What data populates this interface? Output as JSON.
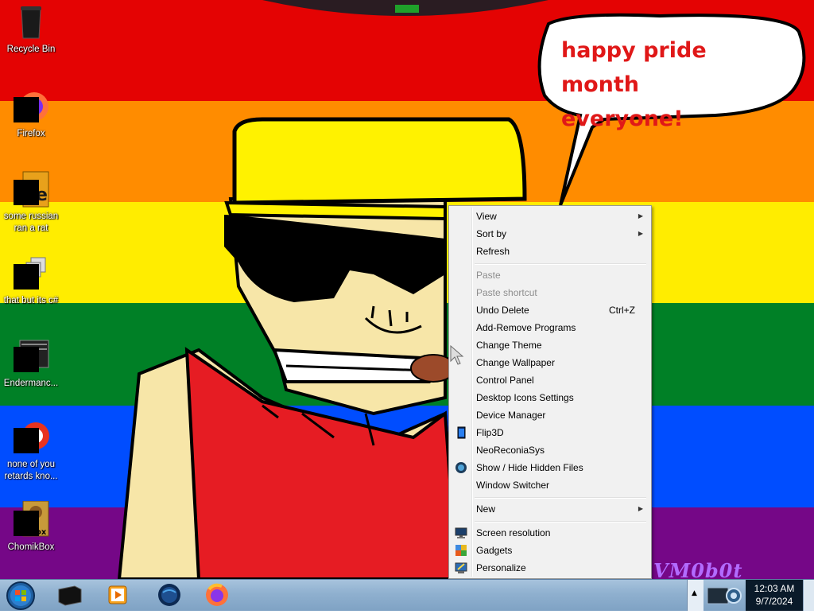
{
  "wallpaper": {
    "speech_bubble_text_line1": "happy pride month",
    "speech_bubble_text_line2": "everyone!",
    "signature": "VM0b0t",
    "flag_colors": [
      "#e40303",
      "#ff8c00",
      "#ffed00",
      "#008026",
      "#004dff",
      "#750787"
    ]
  },
  "desktop_icons": [
    {
      "label": "Recycle Bin",
      "icon": "recycle-bin-icon"
    },
    {
      "label": "Firefox",
      "icon": "firefox-icon"
    },
    {
      "label": "some russian ran a rat",
      "icon": "rat-program-icon"
    },
    {
      "label": "that but its c#",
      "icon": "windows-stack-icon"
    },
    {
      "label": "Endermanc...",
      "icon": "terminal-window-icon"
    },
    {
      "label": "none of you retards kno...",
      "icon": "red-circle-icon"
    },
    {
      "label": "ChomikBox",
      "icon": "chomikbox-hamster-icon"
    }
  ],
  "context_menu": {
    "items": [
      {
        "label": "View",
        "submenu": true
      },
      {
        "label": "Sort by",
        "submenu": true
      },
      {
        "label": "Refresh"
      },
      {
        "label": "Paste",
        "disabled": true
      },
      {
        "label": "Paste shortcut",
        "disabled": true
      },
      {
        "label": "Undo Delete",
        "shortcut": "Ctrl+Z"
      },
      {
        "label": "Add-Remove Programs"
      },
      {
        "label": "Change Theme"
      },
      {
        "label": "Change Wallpaper"
      },
      {
        "label": "Control Panel"
      },
      {
        "label": "Desktop Icons Settings"
      },
      {
        "label": "Device Manager"
      },
      {
        "label": "Flip3D",
        "icon": "flip3d-icon"
      },
      {
        "label": "NeoReconiaSys"
      },
      {
        "label": "Show / Hide Hidden Files",
        "icon": "globe-icon"
      },
      {
        "label": "Window Switcher"
      },
      {
        "label": "New",
        "submenu": true
      },
      {
        "label": "Screen resolution",
        "icon": "display-icon"
      },
      {
        "label": "Gadgets",
        "icon": "gadgets-icon"
      },
      {
        "label": "Personalize",
        "icon": "personalize-icon"
      }
    ],
    "submenu_arrow": "▶"
  },
  "taskbar": {
    "start_button": "windows-orb-icon",
    "pinned": [
      "black-box-app-icon",
      "media-player-icon",
      "globe-browser-icon",
      "firefox-icon"
    ],
    "tray_overflow_arrow": "▲",
    "tray_icon": "camera-projector-icon",
    "clock_time": "12:03 AM",
    "clock_date": "9/7/2024"
  }
}
